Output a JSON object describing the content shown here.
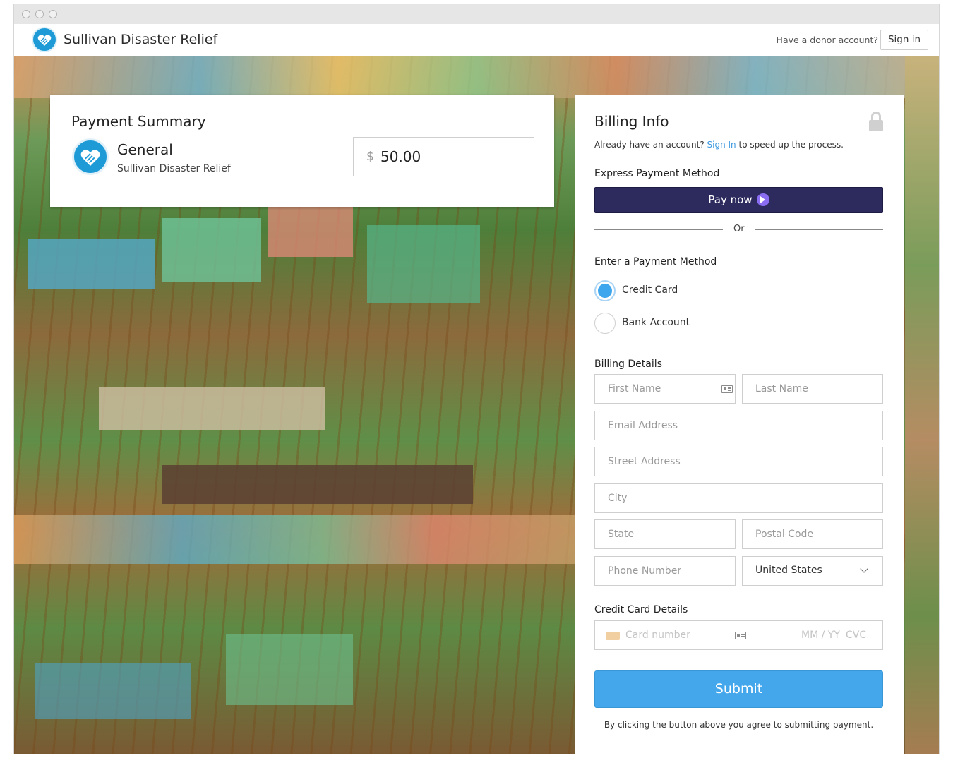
{
  "header": {
    "org_name": "Sullivan Disaster Relief",
    "donor_prompt": "Have a donor account?",
    "sign_in_label": "Sign in"
  },
  "summary": {
    "title": "Payment Summary",
    "fund_name": "General",
    "fund_org": "Sullivan Disaster Relief",
    "currency_symbol": "$",
    "amount": "50.00"
  },
  "billing": {
    "title": "Billing Info",
    "already_prefix": "Already have an account?",
    "already_link": "Sign In",
    "already_suffix": "to speed up the process.",
    "express_label": "Express Payment Method",
    "pay_now_label": "Pay now",
    "or_label": "Or",
    "enter_method_label": "Enter a Payment Method",
    "methods": [
      {
        "label": "Credit Card",
        "selected": true
      },
      {
        "label": "Bank Account",
        "selected": false
      }
    ],
    "details_label": "Billing Details",
    "fields": {
      "first_name": "First Name",
      "last_name": "Last Name",
      "email": "Email Address",
      "street": "Street Address",
      "city": "City",
      "state": "State",
      "postal": "Postal Code",
      "phone": "Phone Number",
      "country": "United States"
    },
    "card_details_label": "Credit Card Details",
    "card_number_placeholder": "Card number",
    "card_expiry_placeholder": "MM / YY",
    "card_cvc_placeholder": "CVC",
    "submit_label": "Submit",
    "agree_text": "By clicking the button above you agree to submitting payment."
  },
  "colors": {
    "accent": "#44a7ec",
    "pay_now_bg": "#2d2a5e",
    "link": "#3a98e0",
    "logo": "#1e9bd7"
  }
}
